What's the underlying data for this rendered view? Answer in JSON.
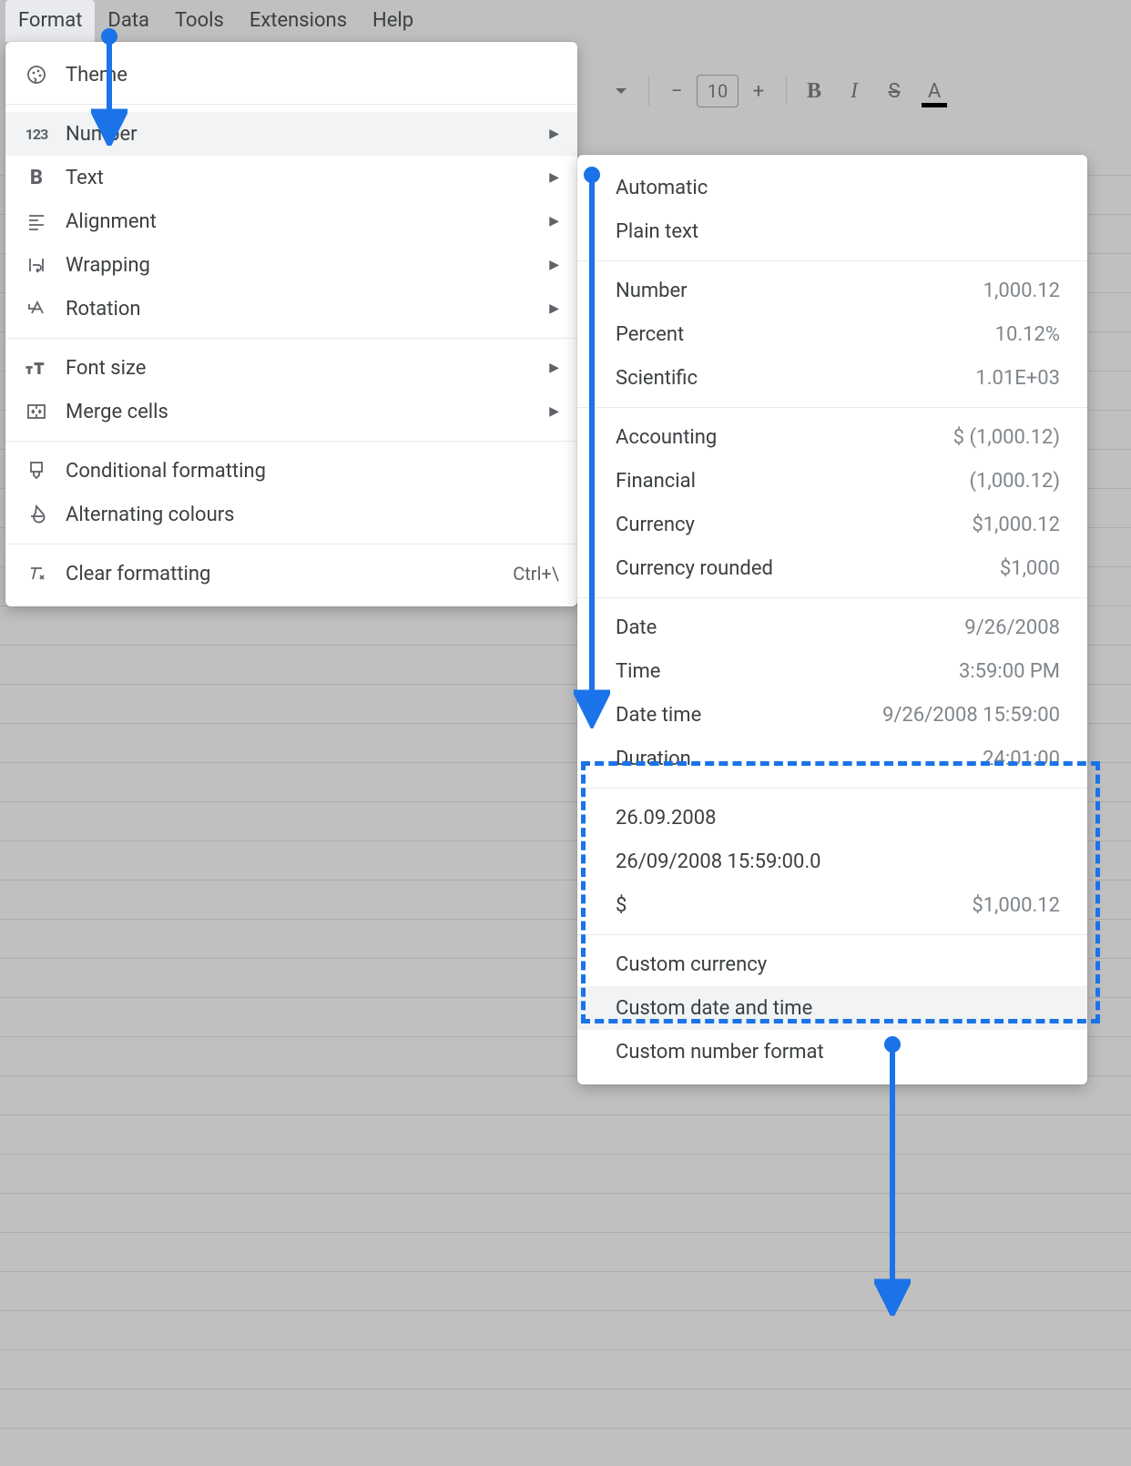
{
  "menubar": {
    "items": [
      "Format",
      "Data",
      "Tools",
      "Extensions",
      "Help"
    ],
    "active_index": 0
  },
  "toolbar": {
    "font_size_value": "10"
  },
  "format_menu": {
    "theme": "Theme",
    "number": "Number",
    "text": "Text",
    "alignment": "Alignment",
    "wrapping": "Wrapping",
    "rotation": "Rotation",
    "font_size": "Font size",
    "merge_cells": "Merge cells",
    "conditional_formatting": "Conditional formatting",
    "alt_colours": "Alternating colours",
    "clear_formatting": "Clear formatting",
    "clear_shortcut": "Ctrl+\\"
  },
  "number_menu": {
    "automatic": "Automatic",
    "plain_text": "Plain text",
    "number": {
      "l": "Number",
      "r": "1,000.12"
    },
    "percent": {
      "l": "Percent",
      "r": "10.12%"
    },
    "scientific": {
      "l": "Scientific",
      "r": "1.01E+03"
    },
    "accounting": {
      "l": "Accounting",
      "r": "$ (1,000.12)"
    },
    "financial": {
      "l": "Financial",
      "r": "(1,000.12)"
    },
    "currency": {
      "l": "Currency",
      "r": "$1,000.12"
    },
    "currency_rounded": {
      "l": "Currency rounded",
      "r": "$1,000"
    },
    "date": {
      "l": "Date",
      "r": "9/26/2008"
    },
    "time": {
      "l": "Time",
      "r": "3:59:00 PM"
    },
    "datetime": {
      "l": "Date time",
      "r": "9/26/2008 15:59:00"
    },
    "duration": {
      "l": "Duration",
      "r": "24:01:00"
    },
    "recent1": "26.09.2008",
    "recent2": "26/09/2008 15:59:00.0",
    "recent3": {
      "l": "$",
      "r": "$1,000.12"
    },
    "custom_currency": "Custom currency",
    "custom_datetime": "Custom date and time",
    "custom_number": "Custom number format"
  },
  "annotation": {
    "arrow_color": "#1a73e8"
  }
}
